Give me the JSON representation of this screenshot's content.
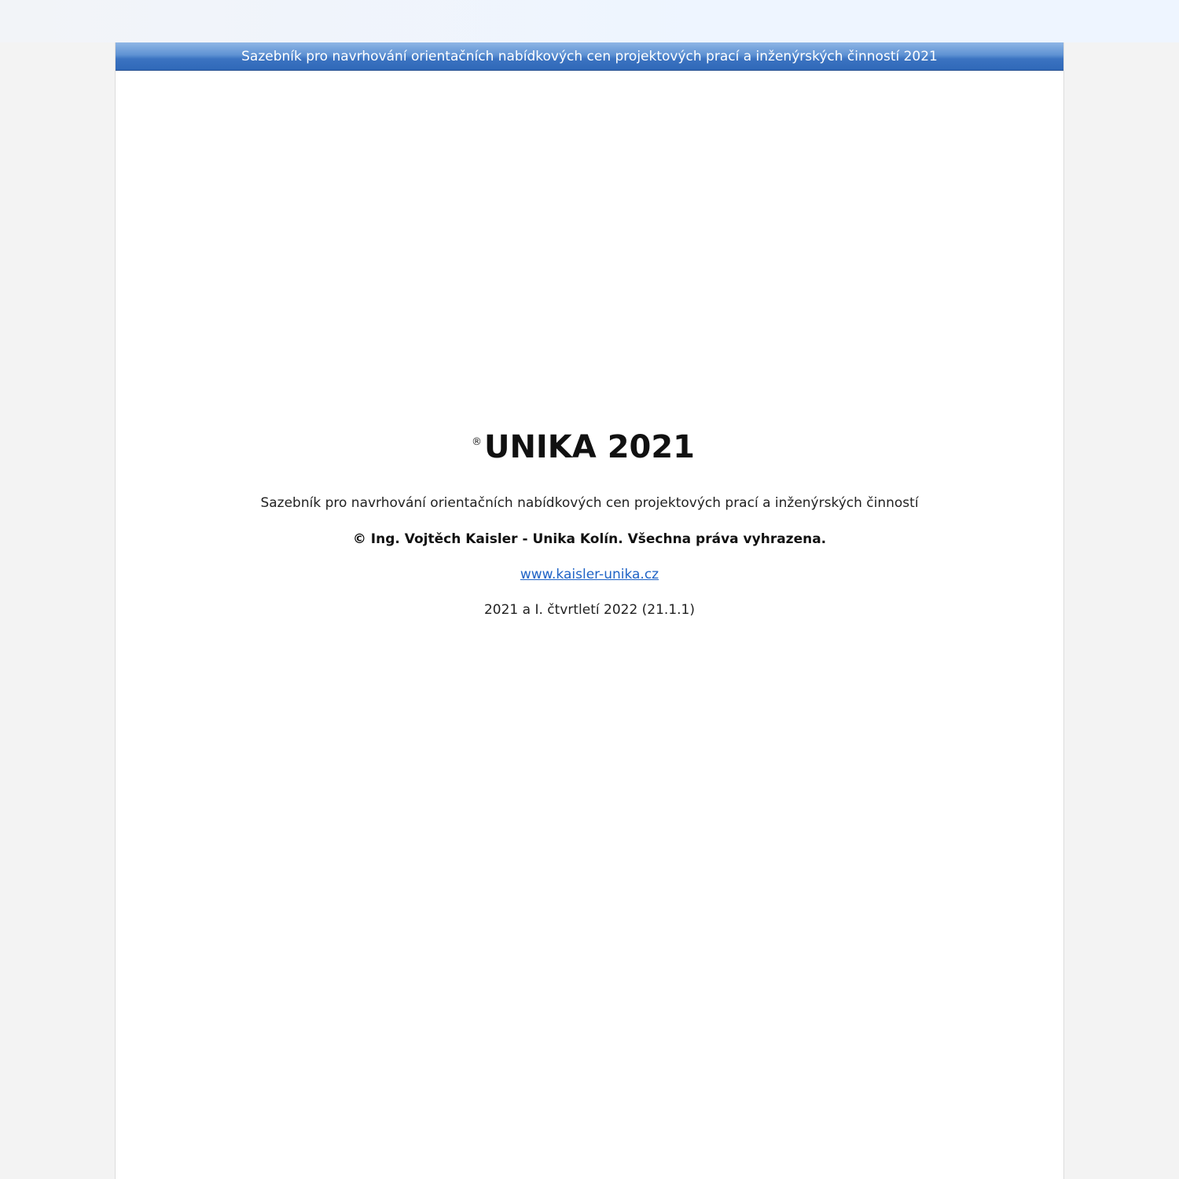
{
  "header": {
    "title": "Sazebník pro navrhování orientačních nabídkových cen projektových prací a inženýrských činností 2021"
  },
  "splash": {
    "registered_mark": "®",
    "app_title": "UNIKA 2021",
    "subtitle": "Sazebník pro navrhování orientačních nabídkových cen projektových prací a inženýrských činností",
    "copyright": "© Ing. Vojtěch Kaisler - Unika Kolín. Všechna práva vyhrazena.",
    "website": "www.kaisler-unika.cz",
    "version": "2021 a I. čtvrtletí 2022 (21.1.1)"
  },
  "colors": {
    "title_bar_top": "#8fb6e6",
    "title_bar_bottom": "#2f68b8",
    "link": "#1f63c6",
    "page_bg": "#ffffff",
    "outer_bg": "#f3f3f3"
  }
}
